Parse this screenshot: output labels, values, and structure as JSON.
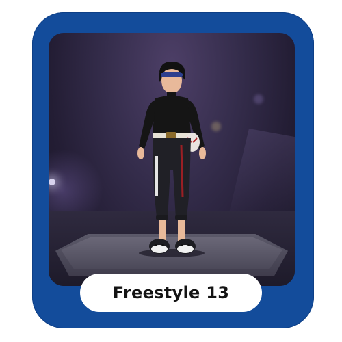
{
  "item": {
    "name": "Freestyle 13"
  },
  "colors": {
    "frame": "#134c9b",
    "scene_background": "#2b2440",
    "pill_background": "#ffffff",
    "pill_text": "#141414"
  }
}
